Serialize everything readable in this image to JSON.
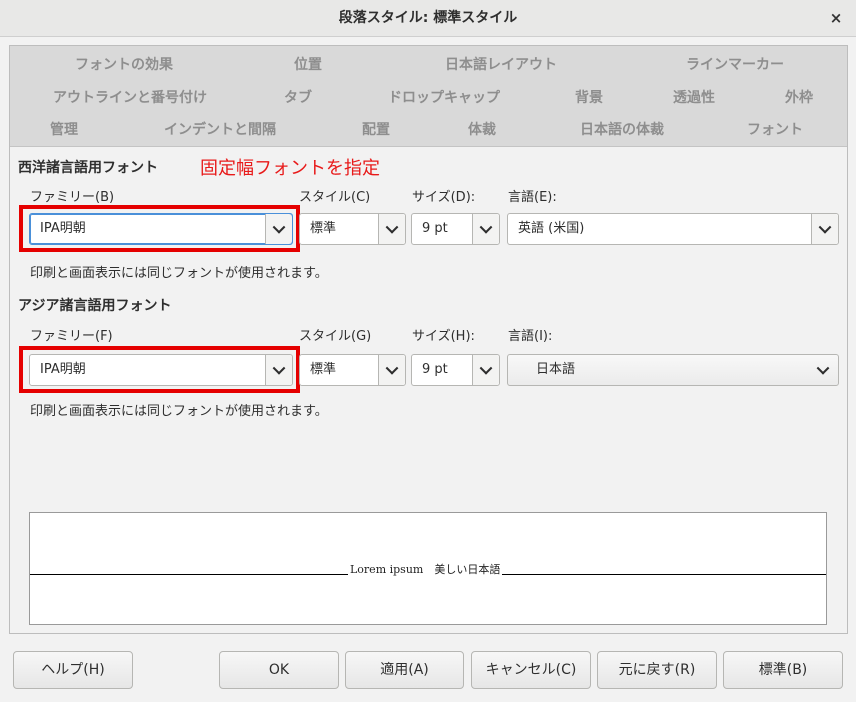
{
  "window": {
    "title": "段落スタイル: 標準スタイル",
    "close_glyph": "×"
  },
  "tabs": {
    "row1": [
      "フォントの効果",
      "位置",
      "日本語レイアウト",
      "ラインマーカー"
    ],
    "row2": [
      "アウトラインと番号付け",
      "タブ",
      "ドロップキャップ",
      "背景",
      "透過性",
      "外枠"
    ],
    "row3": [
      "管理",
      "インデントと間隔",
      "配置",
      "体裁",
      "日本語の体裁",
      "フォント"
    ]
  },
  "western": {
    "section_title": "西洋諸言語用フォント",
    "annotation": "固定幅フォントを指定",
    "family_label": "ファミリー(B)",
    "style_label": "スタイル(C)",
    "size_label": "サイズ(D):",
    "language_label": "言語(E):",
    "family_value": "IPA明朝",
    "style_value": "標準",
    "size_value": "9 pt",
    "language_value": "英語 (米国)",
    "note": "印刷と画面表示には同じフォントが使用されます。"
  },
  "asian": {
    "section_title": "アジア諸言語用フォント",
    "family_label": "ファミリー(F)",
    "style_label": "スタイル(G)",
    "size_label": "サイズ(H):",
    "language_label": "言語(I):",
    "family_value": "IPA明朝",
    "style_value": "標準",
    "size_value": "9 pt",
    "language_value": "日本語",
    "note": "印刷と画面表示には同じフォントが使用されます。"
  },
  "preview": {
    "text": "Lorem ipsum　美しい日本語"
  },
  "buttons": {
    "help": "ヘルプ(H)",
    "ok": "OK",
    "apply": "適用(A)",
    "cancel": "キャンセル(C)",
    "reset": "元に戻す(R)",
    "standard": "標準(B)"
  },
  "colors": {
    "annotation": "#e81a1a",
    "highlight_box": "#e50000",
    "focus": "#4a90d9"
  }
}
